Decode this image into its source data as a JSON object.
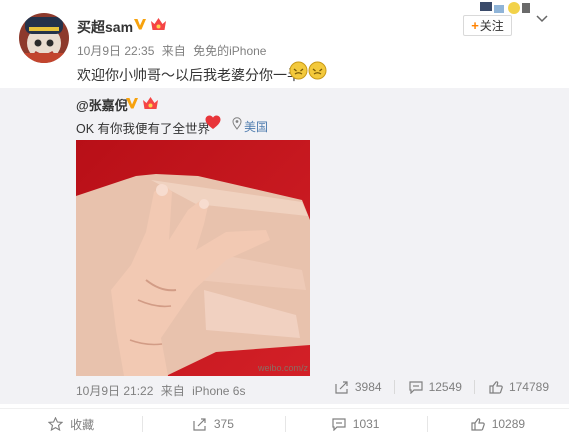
{
  "post": {
    "author": "买超sam",
    "date": "10月9日 22:35",
    "source_prefix": "来自",
    "source": "免免的iPhone",
    "text": "欢迎你小帅哥～以后我老婆分你一半",
    "follow_label": "关注"
  },
  "repost": {
    "author": "@张嘉倪",
    "text": "OK 有你我便有了全世界",
    "location": "美国",
    "image_watermark": "weibo.com/z",
    "date": "10月9日 21:22",
    "source_prefix": "来自",
    "source": "iPhone 6s",
    "stats": {
      "reposts": "3984",
      "comments": "12549",
      "likes": "174789"
    }
  },
  "actions": {
    "favorite": "收藏",
    "repost": "375",
    "comment": "1031",
    "like": "10289"
  },
  "icons": [
    "avatar",
    "verified-v-icon",
    "member-crown-icon",
    "gold-face-emoji-icon",
    "heart-emoji-icon",
    "location-pin-icon",
    "repost-icon",
    "comment-icon",
    "like-icon",
    "star-icon",
    "chevron-down-icon"
  ],
  "colors": {
    "accent": "#ff8200",
    "link": "#507daf",
    "muted": "#808080",
    "repost_bg": "#f2f2f5"
  }
}
